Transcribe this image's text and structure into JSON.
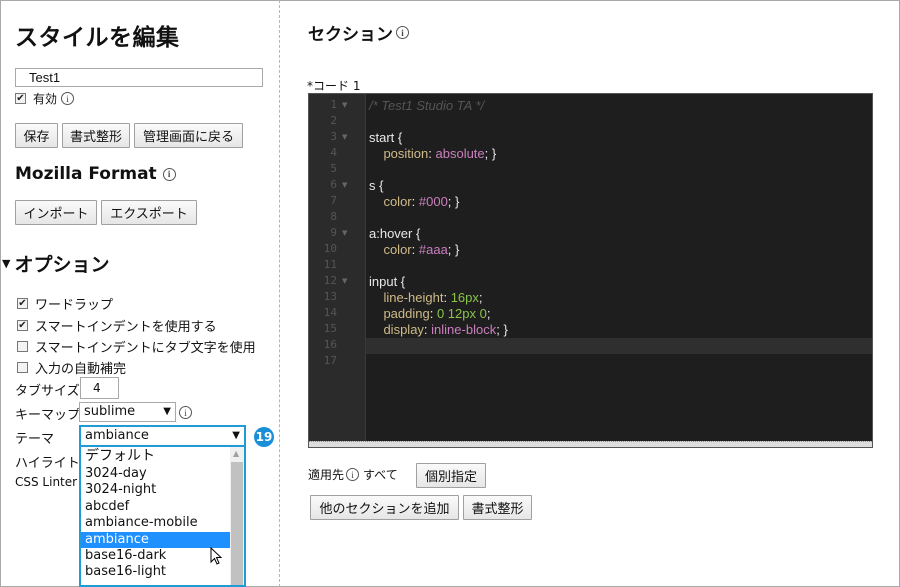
{
  "sidebar": {
    "title": "スタイルを編集",
    "style_name": "Test1",
    "enabled_label": "有効",
    "buttons": {
      "save": "保存",
      "format": "書式整形",
      "back": "管理画面に戻る"
    },
    "mozilla_format": "Mozilla Format",
    "import_export": {
      "import": "インポート",
      "export": "エクスポート"
    },
    "options": {
      "title": "オプション",
      "checkboxes": [
        {
          "label": "ワードラップ",
          "checked": true
        },
        {
          "label": "スマートインデントを使用する",
          "checked": true
        },
        {
          "label": "スマートインデントにタブ文字を使用",
          "checked": false
        },
        {
          "label": "入力の自動補完",
          "checked": false
        }
      ],
      "tab_size_label": "タブサイズ",
      "tab_size_value": "4",
      "keymap_label": "キーマップ",
      "keymap_value": "sublime",
      "theme_label": "テーマ",
      "theme_value": "ambiance",
      "highlight_label": "ハイライト",
      "css_linter_label": "CSS Linter",
      "step_number": "19",
      "theme_options": [
        "デフォルト",
        "3024-day",
        "3024-night",
        "abcdef",
        "ambiance-mobile",
        "ambiance",
        "base16-dark",
        "base16-light"
      ],
      "theme_selected_index": 5
    }
  },
  "main": {
    "section_title": "セクション",
    "code_label": "*コード 1",
    "code_lines": [
      {
        "n": "1",
        "fold": true
      },
      {
        "n": "2"
      },
      {
        "n": "3",
        "fold": true
      },
      {
        "n": "4"
      },
      {
        "n": "5"
      },
      {
        "n": "6",
        "fold": true
      },
      {
        "n": "7"
      },
      {
        "n": "8"
      },
      {
        "n": "9",
        "fold": true
      },
      {
        "n": "10"
      },
      {
        "n": "11"
      },
      {
        "n": "12",
        "fold": true
      },
      {
        "n": "13"
      },
      {
        "n": "14"
      },
      {
        "n": "15"
      },
      {
        "n": "16"
      },
      {
        "n": "17"
      }
    ],
    "code": {
      "l1": "/* Test1 Studio TA */",
      "l3": "start {",
      "l4_prop": "position",
      "l4_val": "absolute",
      "l5": "}",
      "l6": "s {",
      "l7_prop": "color",
      "l7_val": "#000",
      "l8": "}",
      "l9": "a:hover {",
      "l10_prop": "color",
      "l10_val": "#aaa",
      "l11": "}",
      "l12": "input {",
      "l13_prop": "line-height",
      "l13_val": "16px",
      "l14_prop": "padding",
      "l14_val": "0 12px 0",
      "l15_prop": "display",
      "l15_val": "inline-block",
      "l16": "}"
    },
    "apply_label": "適用先",
    "apply_value": "すべて",
    "individual_button": "個別指定",
    "add_section_button": "他のセクションを追加",
    "format_button": "書式整形"
  },
  "colors": {
    "accent": "#1f9cd8",
    "selected": "#1e90ff",
    "editor_bg": "#1e1e1e"
  }
}
